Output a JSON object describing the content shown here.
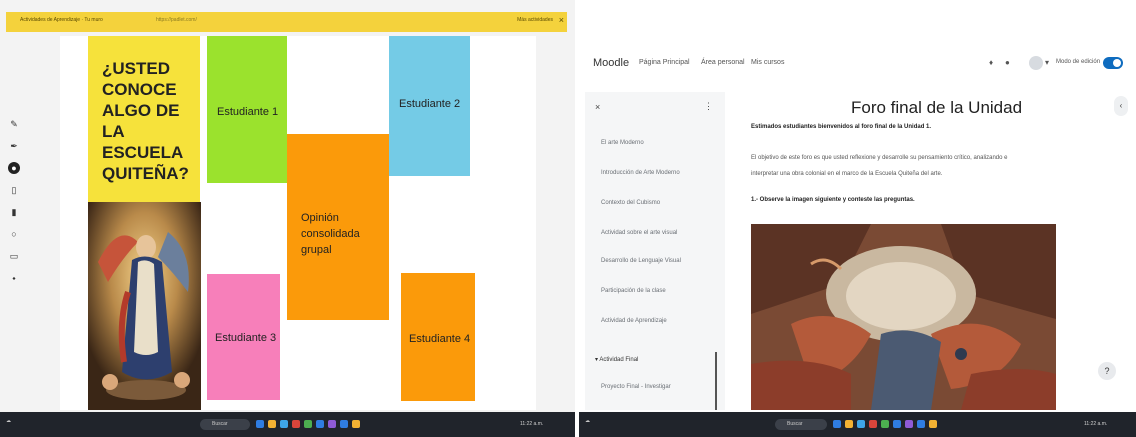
{
  "left_screen": {
    "banner": {
      "text": "Actividades de Aprendizaje · Tu muro",
      "link": "https://padlet.com/",
      "right": "Más actividades"
    },
    "title_card": {
      "text": "¿USTED CONOCE ALGO DE LA ESCUELA QUITEÑA?"
    },
    "notes": [
      {
        "label": "Estudiante 1",
        "color": "#9be22d"
      },
      {
        "label": "Estudiante 2",
        "color": "#74cbe6"
      },
      {
        "label": "Opinión consolidada grupal",
        "color": "#fb9a0a"
      },
      {
        "label": "Estudiante 3",
        "color": "#f77fba"
      },
      {
        "label": "Estudiante 4",
        "color": "#fb9a0a"
      }
    ],
    "tools": [
      "pencil-icon",
      "pen-icon",
      "select-icon",
      "eraser-icon",
      "marker-icon",
      "circle-icon",
      "text-icon",
      "pin-icon"
    ]
  },
  "right_screen": {
    "brand": "Moodle",
    "nav": [
      "Página Principal",
      "Área personal",
      "Mis cursos"
    ],
    "edit_mode_label": "Modo de edición",
    "sidebar": {
      "items": [
        "El arte Moderno",
        "Introducción de Arte Moderno",
        "Contexto del Cubismo",
        "Actividad sobre el arte visual",
        "Desarrollo de Lenguaje Visual",
        "Participación de la clase",
        "Actividad de Aprendizaje"
      ],
      "section": "Actividad Final",
      "section_item": "Proyecto Final - Investigar"
    },
    "page_title": "Foro final de la Unidad",
    "greeting": "Estimados estudiantes bienvenidos al foro final de la Unidad 1.",
    "intro_line1": "El objetivo de este foro es que usted reflexione y desarrolle su pensamiento crítico, analizando e",
    "intro_line2": "interpretar una obra colonial en el marco de la Escuela Quiteña del arte.",
    "question": "1.- Observe la imagen siguiente y conteste las preguntas."
  },
  "taskbar": {
    "search_label": "Buscar",
    "clock": "11:22 a.m."
  },
  "colors": {
    "banner": "#f4d23c",
    "title_card": "#f6e23b",
    "moodle_blue": "#0f6cbf",
    "taskbar": "#20242b"
  }
}
